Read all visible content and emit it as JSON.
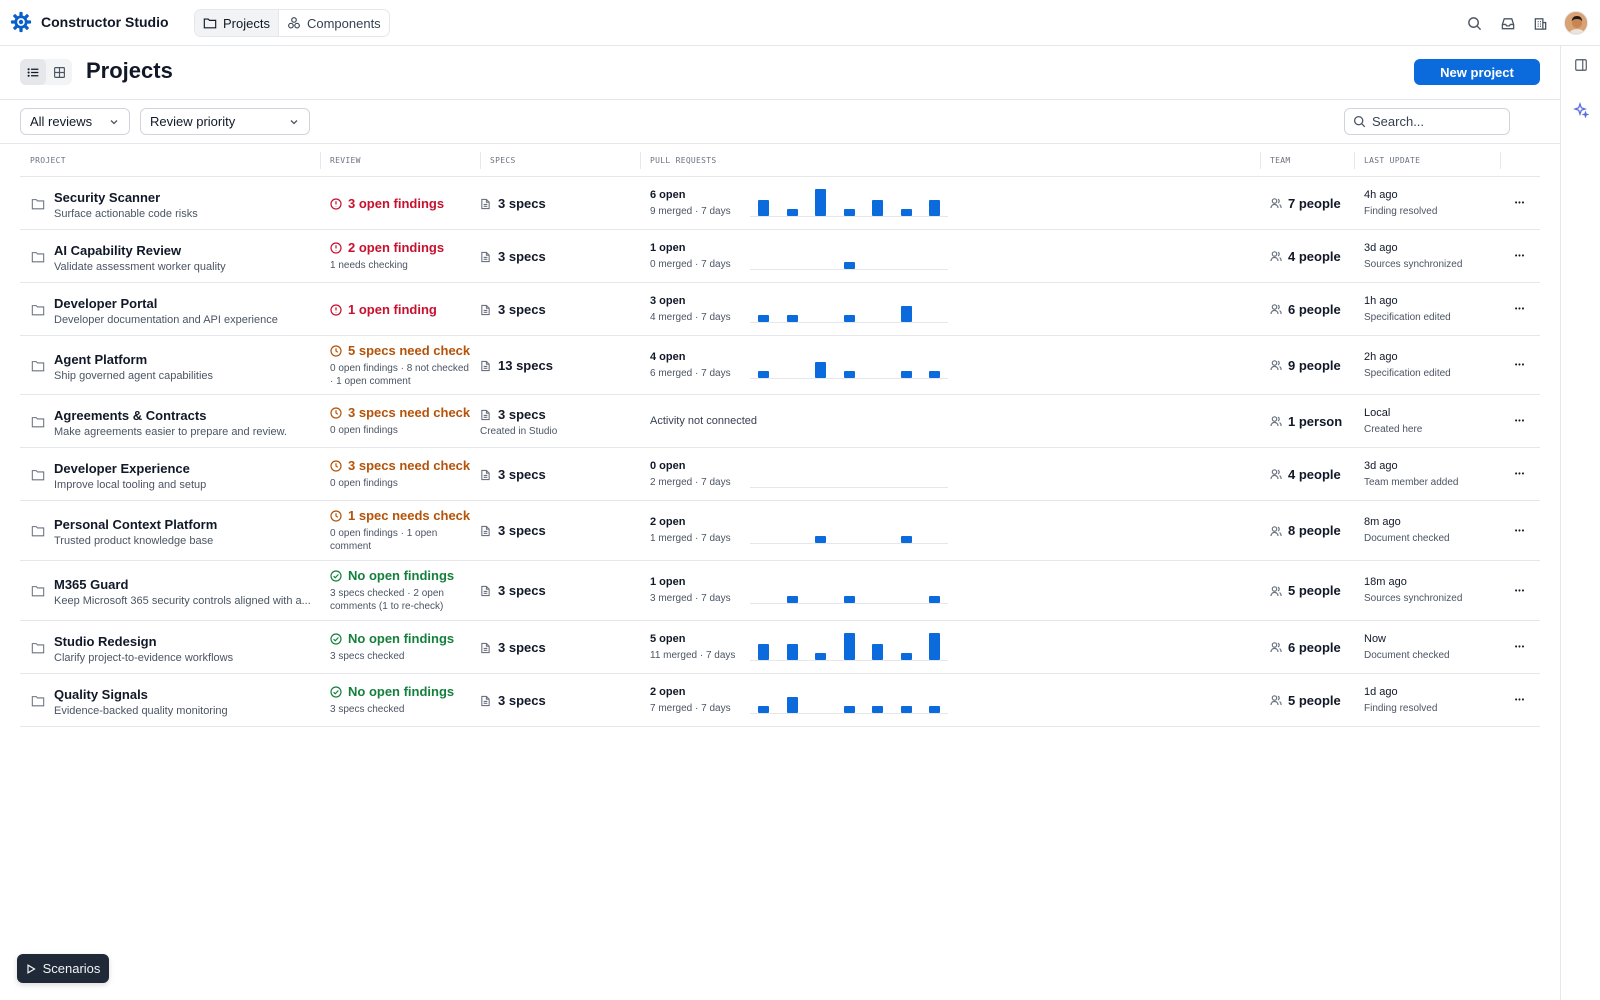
{
  "app": {
    "name": "Constructor Studio"
  },
  "nav": {
    "tabs": [
      {
        "label": "Projects",
        "icon": "folder-icon"
      },
      {
        "label": "Components",
        "icon": "components-icon"
      }
    ]
  },
  "header": {
    "title": "Projects",
    "new_button": "New project"
  },
  "filters": {
    "review": "All reviews",
    "sort": "Review priority",
    "search_placeholder": "Search..."
  },
  "columns": {
    "project": "PROJECT",
    "review": "REVIEW",
    "specs": "SPECS",
    "pull_requests": "PULL REQUESTS",
    "team": "TEAM",
    "last_update": "LAST UPDATE"
  },
  "colors": {
    "accent": "#0b6bdc",
    "danger": "#c8102e",
    "warning": "#b45309",
    "success": "#15803d"
  },
  "pr_activity_days": 7,
  "rows": [
    {
      "name": "Security Scanner",
      "desc": "Surface actionable code risks",
      "review_status": "danger",
      "review": "3 open findings",
      "review_sub": "",
      "specs": "3 specs",
      "specs_sub": "",
      "pr_open": "6 open",
      "pr_merged": "9 merged · 7 days",
      "pr_activity": [
        3,
        1,
        5,
        1,
        3,
        1,
        3
      ],
      "team": "7 people",
      "update_time": "4h ago",
      "update_what": "Finding resolved"
    },
    {
      "name": "AI Capability Review",
      "desc": "Validate assessment worker quality",
      "review_status": "danger",
      "review": "2 open findings",
      "review_sub": "1 needs checking",
      "specs": "3 specs",
      "specs_sub": "",
      "pr_open": "1 open",
      "pr_merged": "0 merged · 7 days",
      "pr_activity": [
        0,
        0,
        0,
        1,
        0,
        0,
        0
      ],
      "team": "4 people",
      "update_time": "3d ago",
      "update_what": "Sources synchronized"
    },
    {
      "name": "Developer Portal",
      "desc": "Developer documentation and API experience",
      "review_status": "danger",
      "review": "1 open finding",
      "review_sub": "",
      "specs": "3 specs",
      "specs_sub": "",
      "pr_open": "3 open",
      "pr_merged": "4 merged · 7 days",
      "pr_activity": [
        1,
        1,
        0,
        1,
        0,
        3,
        0
      ],
      "team": "6 people",
      "update_time": "1h ago",
      "update_what": "Specification edited"
    },
    {
      "name": "Agent Platform",
      "desc": "Ship governed agent capabilities",
      "review_status": "warning",
      "review": "5 specs need check",
      "review_sub": "0 open findings · 8 not checked · 1 open comment",
      "specs": "13 specs",
      "specs_sub": "",
      "pr_open": "4 open",
      "pr_merged": "6 merged · 7 days",
      "pr_activity": [
        1,
        0,
        3,
        1,
        0,
        1,
        1
      ],
      "team": "9 people",
      "update_time": "2h ago",
      "update_what": "Specification edited"
    },
    {
      "name": "Agreements & Contracts",
      "desc": "Make agreements easier to prepare and review.",
      "review_status": "warning",
      "review": "3 specs need check",
      "review_sub": "0 open findings",
      "specs": "3 specs",
      "specs_sub": "Created in Studio",
      "pr_open": "",
      "pr_merged": "",
      "pr_note": "Activity not connected",
      "pr_activity": [],
      "team": "1 person",
      "update_time": "Local",
      "update_what": "Created here"
    },
    {
      "name": "Developer Experience",
      "desc": "Improve local tooling and setup",
      "review_status": "warning",
      "review": "3 specs need check",
      "review_sub": "0 open findings",
      "specs": "3 specs",
      "specs_sub": "",
      "pr_open": "0 open",
      "pr_merged": "2 merged · 7 days",
      "pr_activity": [
        0,
        0,
        0,
        0,
        0,
        0,
        0
      ],
      "team": "4 people",
      "update_time": "3d ago",
      "update_what": "Team member added"
    },
    {
      "name": "Personal Context Platform",
      "desc": "Trusted product knowledge base",
      "review_status": "warning",
      "review": "1 spec needs check",
      "review_sub": "0 open findings · 1 open comment",
      "specs": "3 specs",
      "specs_sub": "",
      "pr_open": "2 open",
      "pr_merged": "1 merged · 7 days",
      "pr_activity": [
        0,
        0,
        1,
        0,
        0,
        1,
        0
      ],
      "team": "8 people",
      "update_time": "8m ago",
      "update_what": "Document checked"
    },
    {
      "name": "M365 Guard",
      "desc": "Keep Microsoft 365 security controls aligned with a...",
      "review_status": "success",
      "review": "No open findings",
      "review_sub": "3 specs checked · 2 open comments (1 to re-check)",
      "specs": "3 specs",
      "specs_sub": "",
      "pr_open": "1 open",
      "pr_merged": "3 merged · 7 days",
      "pr_activity": [
        0,
        1,
        0,
        1,
        0,
        0,
        1
      ],
      "team": "5 people",
      "update_time": "18m ago",
      "update_what": "Sources synchronized"
    },
    {
      "name": "Studio Redesign",
      "desc": "Clarify project-to-evidence workflows",
      "review_status": "success",
      "review": "No open findings",
      "review_sub": "3 specs checked",
      "specs": "3 specs",
      "specs_sub": "",
      "pr_open": "5 open",
      "pr_merged": "11 merged · 7 days",
      "pr_activity": [
        3,
        3,
        1,
        5,
        3,
        1,
        5
      ],
      "team": "6 people",
      "update_time": "Now",
      "update_what": "Document checked"
    },
    {
      "name": "Quality Signals",
      "desc": "Evidence-backed quality monitoring",
      "review_status": "success",
      "review": "No open findings",
      "review_sub": "3 specs checked",
      "specs": "3 specs",
      "specs_sub": "",
      "pr_open": "2 open",
      "pr_merged": "7 merged · 7 days",
      "pr_activity": [
        1,
        3,
        0,
        1,
        1,
        1,
        1
      ],
      "team": "5 people",
      "update_time": "1d ago",
      "update_what": "Finding resolved"
    }
  ],
  "scenarios": {
    "label": "Scenarios"
  }
}
